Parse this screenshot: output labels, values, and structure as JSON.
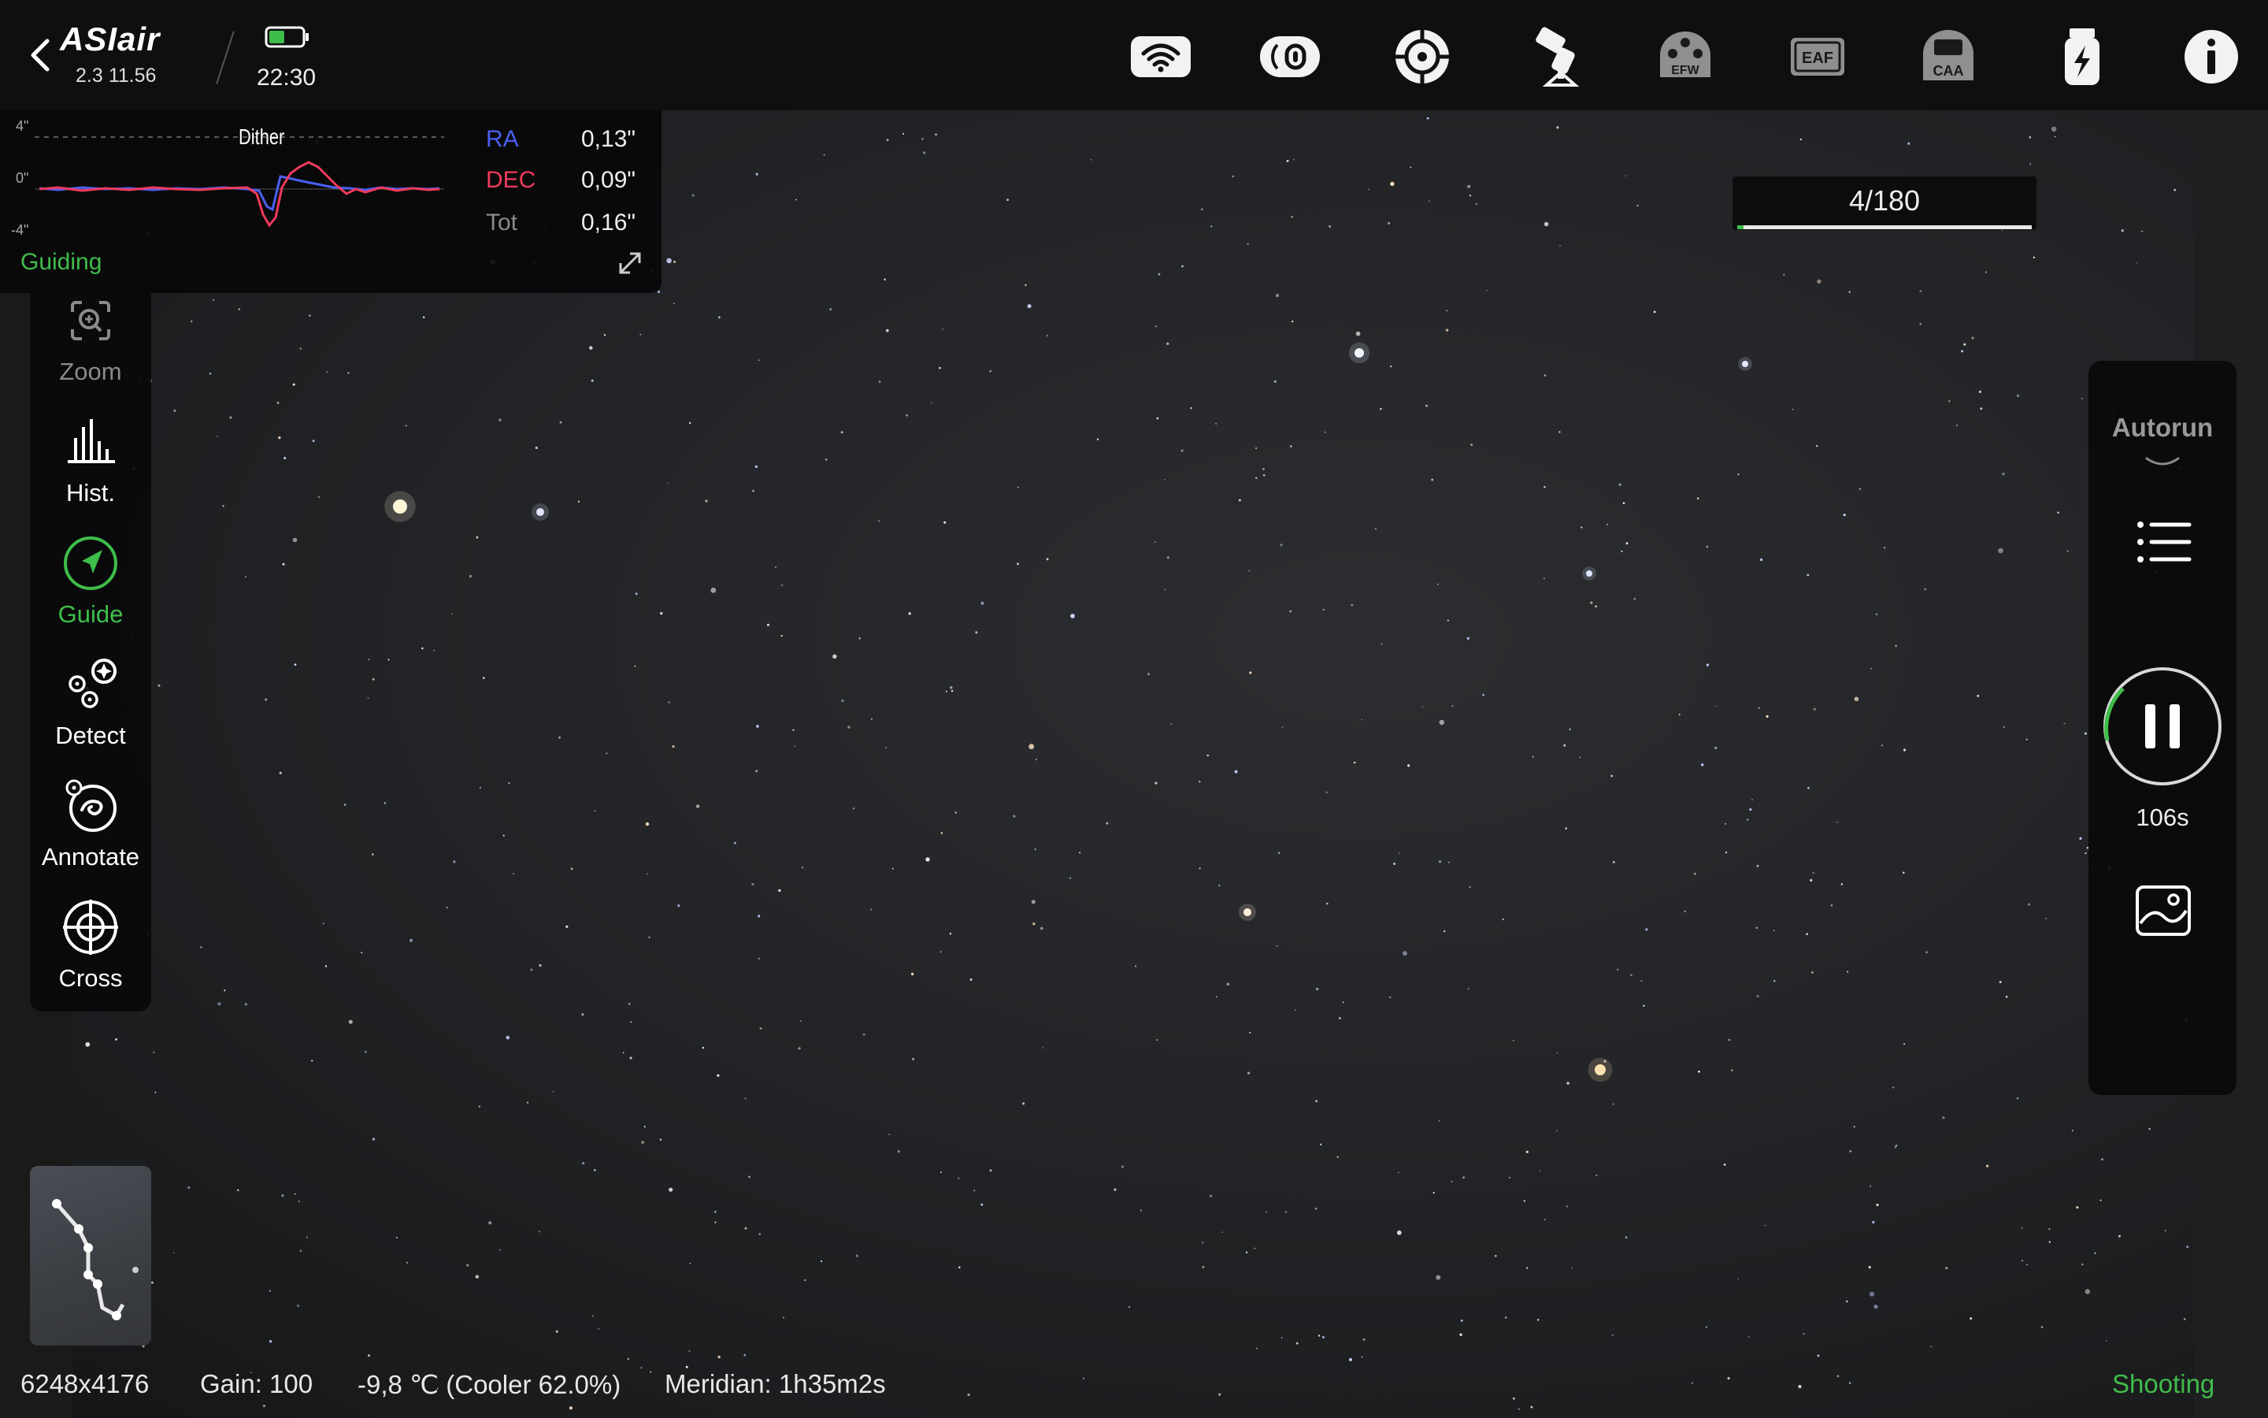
{
  "app": {
    "logo_text": "ASIair",
    "version": "2.3 11.56",
    "time": "22:30",
    "battery_level": 0.45
  },
  "status_icons": [
    {
      "name": "wifi-icon",
      "label": ""
    },
    {
      "name": "camera-icon",
      "label": ""
    },
    {
      "name": "guide-scope-icon",
      "label": ""
    },
    {
      "name": "mount-icon",
      "label": ""
    },
    {
      "name": "efw-icon",
      "label": "EFW"
    },
    {
      "name": "eaf-icon",
      "label": "EAF"
    },
    {
      "name": "caa-icon",
      "label": "CAA"
    },
    {
      "name": "power-icon",
      "label": ""
    },
    {
      "name": "info-icon",
      "label": ""
    }
  ],
  "guiding": {
    "axis_top": "4\"",
    "axis_mid": "0\"",
    "axis_bottom": "-4\"",
    "dither_label": "Dither",
    "ra_label": "RA",
    "ra_value": "0,13\"",
    "dec_label": "DEC",
    "dec_value": "0,09\"",
    "tot_label": "Tot",
    "tot_value": "0,16\"",
    "status": "Guiding",
    "ra_color": "#4b5ff0",
    "dec_color": "#f03a5c"
  },
  "toolbar": {
    "zoom": "Zoom",
    "hist": "Hist.",
    "guide": "Guide",
    "detect": "Detect",
    "annotate": "Annotate",
    "cross": "Cross"
  },
  "frames": {
    "text": "4/180",
    "progress": 0.022
  },
  "autorun": {
    "label": "Autorun",
    "countdown": "106s"
  },
  "bottom": {
    "resolution": "6248x4176",
    "gain": "Gain: 100",
    "temperature": "-9,8 ℃ (Cooler 62.0%)",
    "meridian": "Meridian: 1h35m2s",
    "state": "Shooting"
  },
  "colors": {
    "accent_green": "#3fbd4a"
  }
}
